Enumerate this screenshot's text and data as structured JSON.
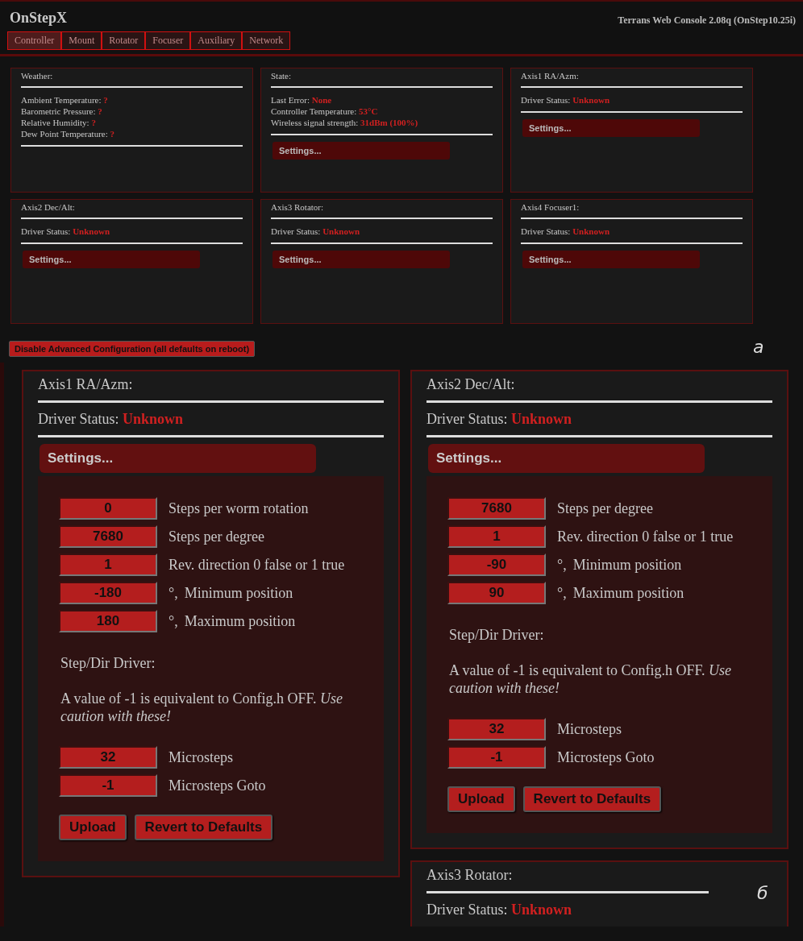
{
  "panel_a": {
    "figure_label": "а",
    "header": {
      "title": "OnStepX",
      "version": "Terrans Web Console 2.08q (OnStep10.25i)",
      "tabs": [
        {
          "label": "Controller",
          "selected": true
        },
        {
          "label": "Mount",
          "selected": false
        },
        {
          "label": "Rotator",
          "selected": false
        },
        {
          "label": "Focuser",
          "selected": false
        },
        {
          "label": "Auxiliary",
          "selected": false
        },
        {
          "label": "Network",
          "selected": false
        }
      ]
    },
    "cards": [
      {
        "title": "Weather:",
        "rows": [
          {
            "label": "Ambient Temperature:",
            "value": "?"
          },
          {
            "label": "Barometric Pressure:",
            "value": "?"
          },
          {
            "label": "Relative Humidity:",
            "value": "?"
          },
          {
            "label": "Dew Point Temperature:",
            "value": "?"
          }
        ]
      },
      {
        "title": "State:",
        "rows": [
          {
            "label": "Last Error:",
            "value": "None"
          },
          {
            "label": "Controller Temperature:",
            "value": "53°C"
          },
          {
            "label": "Wireless signal strength:",
            "value": "31dBm (100%)"
          }
        ],
        "button": "Settings..."
      },
      {
        "title": "Axis1 RA/Azm:",
        "rows": [
          {
            "label": "Driver Status:",
            "value": "Unknown"
          }
        ],
        "button": "Settings..."
      },
      {
        "title": "Axis2 Dec/Alt:",
        "rows": [
          {
            "label": "Driver Status:",
            "value": "Unknown"
          }
        ],
        "button": "Settings..."
      },
      {
        "title": "Axis3 Rotator:",
        "rows": [
          {
            "label": "Driver Status:",
            "value": "Unknown"
          }
        ],
        "button": "Settings..."
      },
      {
        "title": "Axis4 Focuser1:",
        "rows": [
          {
            "label": "Driver Status:",
            "value": "Unknown"
          }
        ],
        "button": "Settings..."
      }
    ],
    "disable_button": "Disable Advanced Configuration (all defaults on reboot)"
  },
  "panel_b": {
    "figure_label": "б",
    "columns": [
      [
        {
          "title": "Axis1 RA/Azm:",
          "status_label": "Driver Status:",
          "status_value": "Unknown",
          "settings_button": "Settings...",
          "fields": [
            {
              "value": "0",
              "label": "Steps per worm rotation"
            },
            {
              "value": "7680",
              "label": "Steps per degree"
            },
            {
              "value": "1",
              "label": "Rev. direction 0 false or 1 true"
            },
            {
              "value": "-180",
              "unit": "°,",
              "label": "Minimum position"
            },
            {
              "value": "180",
              "unit": "°,",
              "label": "Maximum position"
            }
          ],
          "section": "Step/Dir Driver:",
          "note": "A value of -1 is equivalent to Config.h OFF. *Use caution with these!*",
          "driver_fields": [
            {
              "value": "32",
              "label": "Microsteps"
            },
            {
              "value": "-1",
              "label": "Microsteps Goto"
            }
          ],
          "buttons": [
            "Upload",
            "Revert to Defaults"
          ]
        }
      ],
      [
        {
          "title": "Axis2 Dec/Alt:",
          "status_label": "Driver Status:",
          "status_value": "Unknown",
          "settings_button": "Settings...",
          "fields": [
            {
              "value": "7680",
              "label": "Steps per degree"
            },
            {
              "value": "1",
              "label": "Rev. direction 0 false or 1 true"
            },
            {
              "value": "-90",
              "unit": "°,",
              "label": "Minimum position"
            },
            {
              "value": "90",
              "unit": "°,",
              "label": "Maximum position"
            }
          ],
          "section": "Step/Dir Driver:",
          "note": "A value of -1 is equivalent to Config.h OFF. *Use caution with these!*",
          "driver_fields": [
            {
              "value": "32",
              "label": "Microsteps"
            },
            {
              "value": "-1",
              "label": "Microsteps Goto"
            }
          ],
          "buttons": [
            "Upload",
            "Revert to Defaults"
          ]
        },
        {
          "title": "Axis3 Rotator:",
          "status_label": "Driver Status:",
          "status_value": "Unknown"
        }
      ]
    ]
  }
}
